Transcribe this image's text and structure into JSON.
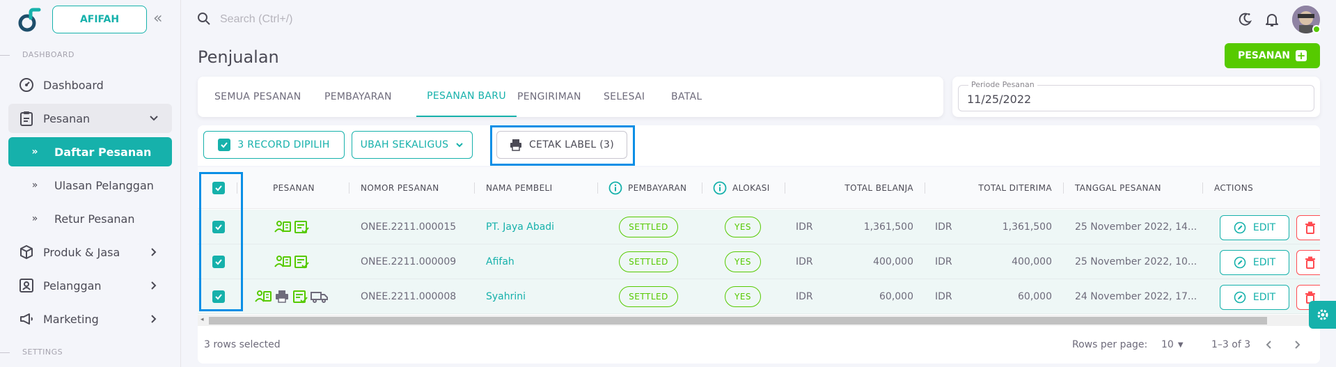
{
  "sidebar": {
    "shop_name": "AFIFAH",
    "sections": {
      "dashboard": "DASHBOARD",
      "settings": "SETTINGS"
    },
    "items": {
      "dashboard": "Dashboard",
      "pesanan": "Pesanan",
      "daftar_pesanan": "Daftar Pesanan",
      "ulasan": "Ulasan Pelanggan",
      "retur": "Retur Pesanan",
      "produk": "Produk & Jasa",
      "pelanggan": "Pelanggan",
      "marketing": "Marketing"
    },
    "bullet": "»"
  },
  "topbar": {
    "search_placeholder": "Search (Ctrl+/)"
  },
  "page": {
    "title": "Penjualan",
    "add_button": "PESANAN"
  },
  "tabs": [
    "SEMUA PESANAN",
    "PEMBAYARAN",
    "PESANAN BARU",
    "PENGIRIMAN",
    "SELESAI",
    "BATAL"
  ],
  "active_tab": "PESANAN BARU",
  "period": {
    "label": "Periode Pesanan",
    "value": "11/25/2022"
  },
  "toolbar": {
    "selected": "3 RECORD DIPILIH",
    "bulk": "UBAH SEKALIGUS",
    "print": "CETAK LABEL (3)"
  },
  "table": {
    "headers": {
      "pesanan": "PESANAN",
      "nomor": "NOMOR PESANAN",
      "nama": "NAMA PEMBELI",
      "pembayaran": "PEMBAYARAN",
      "alokasi": "ALOKASI",
      "total_belanja": "TOTAL BELANJA",
      "total_diterima": "TOTAL DITERIMA",
      "tanggal": "TANGGAL PESANAN",
      "actions": "ACTIONS"
    },
    "rows": [
      {
        "nomor": "ONEE.2211.000015",
        "nama": "PT. Jaya Abadi",
        "pembayaran": "SETTLED",
        "alokasi": "YES",
        "cur1": "IDR",
        "belanja": "1,361,500",
        "cur2": "IDR",
        "diterima": "1,361,500",
        "tanggal": "25 November 2022, 14...",
        "edit": "EDIT"
      },
      {
        "nomor": "ONEE.2211.000009",
        "nama": "Afifah",
        "pembayaran": "SETTLED",
        "alokasi": "YES",
        "cur1": "IDR",
        "belanja": "400,000",
        "cur2": "IDR",
        "diterima": "400,000",
        "tanggal": "25 November 2022, 10...",
        "edit": "EDIT"
      },
      {
        "nomor": "ONEE.2211.000008",
        "nama": "Syahrini",
        "pembayaran": "SETTLED",
        "alokasi": "YES",
        "cur1": "IDR",
        "belanja": "60,000",
        "cur2": "IDR",
        "diterima": "60,000",
        "tanggal": "24 November 2022, 17...",
        "edit": "EDIT"
      }
    ],
    "row_icons": [
      [
        "payment-icon",
        "checklist-icon"
      ],
      [
        "payment-icon",
        "checklist-icon"
      ],
      [
        "payment-icon",
        "printer-icon",
        "checklist-icon",
        "truck-icon"
      ]
    ]
  },
  "footer": {
    "selected": "3 rows selected",
    "rows_per_page_label": "Rows per page:",
    "rows_per_page": "10",
    "range": "1–3 of 3"
  },
  "colors": {
    "accent": "#16b1ab",
    "success": "#56ca00",
    "danger": "#ff4c51",
    "highlight": "#0a8fe6"
  }
}
